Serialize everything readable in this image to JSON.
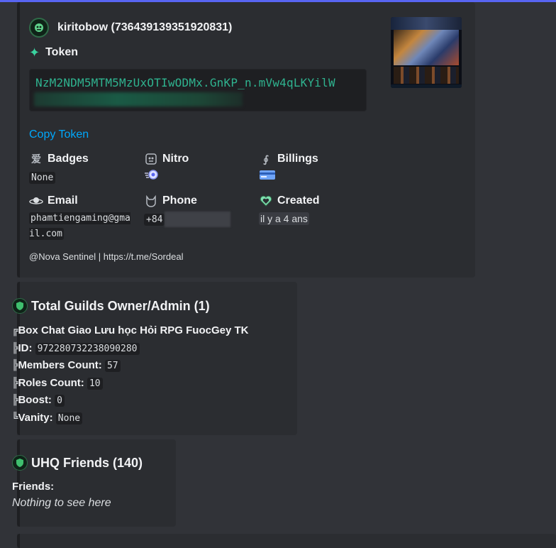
{
  "accent_color": "#5865f2",
  "link_color": "#00a8fc",
  "account": {
    "author": "kiritobow (736439139351920831)",
    "token_title": "Token",
    "token_value": "NzM2NDM5MTM5MzUxOTIwODMx.GnKP_n.mVw4qLKYilW",
    "copy_label": "Copy Token",
    "badges": {
      "label": "Badges",
      "value": "None"
    },
    "nitro": {
      "label": "Nitro"
    },
    "billings": {
      "label": "Billings"
    },
    "email": {
      "label": "Email",
      "value": "phamtiengaming@gmail.com"
    },
    "phone": {
      "label": "Phone",
      "value": "+84"
    },
    "created": {
      "label": "Created",
      "value": "il y a 4 ans"
    },
    "footer": "@Nova Sentinel | https://t.me/Sordeal"
  },
  "guilds": {
    "title": "Total Guilds Owner/Admin (1)",
    "name": "Box Chat Giao Lưu học Hỏi RPG FuocGey TK",
    "id_label": "ID:",
    "id_value": "972280732238090280",
    "members_label": "Members Count:",
    "members_value": "57",
    "roles_label": "Roles Count:",
    "roles_value": "10",
    "boost_label": "Boost:",
    "boost_value": "0",
    "vanity_label": "Vanity:",
    "vanity_value": "None"
  },
  "friends": {
    "title": "UHQ Friends (140)",
    "label": "Friends:",
    "empty": "Nothing to see here"
  },
  "icons": [
    "avatar-icon",
    "sparkle-icon",
    "badges-icon",
    "nitro-icon",
    "billings-icon",
    "email-icon",
    "phone-icon",
    "created-heart-icon",
    "shield-icon",
    "thumbnail-image",
    "nitro-badge-icon",
    "credit-card-icon"
  ]
}
